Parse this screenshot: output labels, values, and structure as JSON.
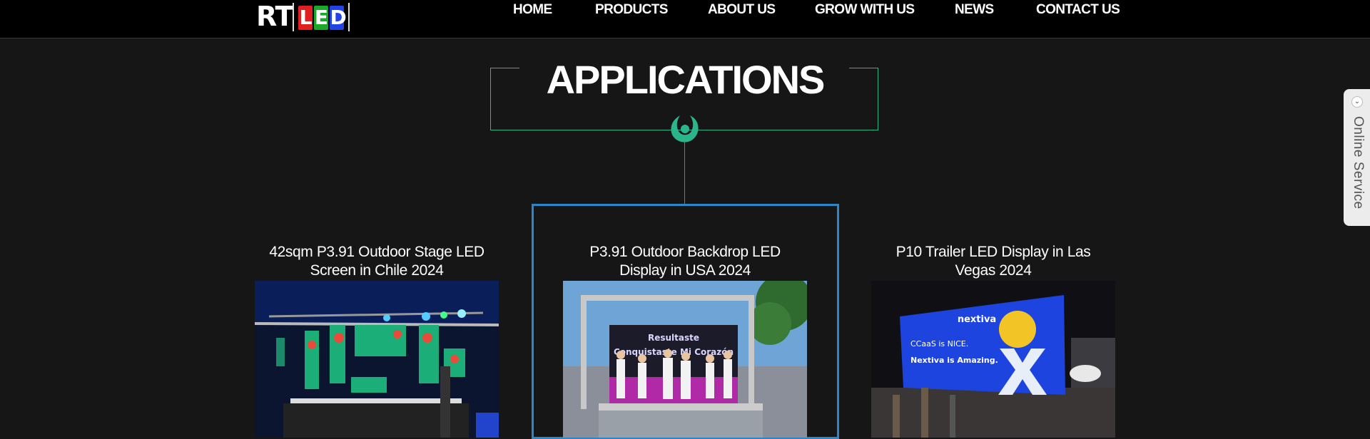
{
  "header": {
    "logo": {
      "text": "RT",
      "letters": [
        "L",
        "E",
        "D"
      ],
      "letter_colors": [
        "#e02020",
        "#1aa82a",
        "#2244e6"
      ]
    },
    "nav": [
      {
        "label": "HOME"
      },
      {
        "label": "PRODUCTS"
      },
      {
        "label": "ABOUT US"
      },
      {
        "label": "GROW WITH US"
      },
      {
        "label": "NEWS"
      },
      {
        "label": "CONTACT US"
      }
    ]
  },
  "section": {
    "title": "APPLICATIONS",
    "accent_color": "#2bb58a",
    "icon": "drop-icon"
  },
  "cards": [
    {
      "title_line1": "42sqm P3.91 Outdoor Stage LED",
      "title_line2": "Screen in Chile 2024",
      "image": "stage-led-screen-image",
      "selected": false
    },
    {
      "title_line1": "P3.91 Outdoor Backdrop LED",
      "title_line2": "Display in USA 2024",
      "image": "backdrop-led-display-image",
      "selected": true,
      "image_text": [
        "Resultaste",
        "Conquistaste Mi Corazón"
      ]
    },
    {
      "title_line1": "P10 Trailer LED Display in Las",
      "title_line2": "Vegas 2024",
      "image": "trailer-led-display-image",
      "selected": false,
      "image_text": [
        "nextiva",
        "CCaaS is NICE.",
        "Nextiva is Amazing."
      ]
    }
  ],
  "highlight_color": "#2e86c8",
  "online_service": {
    "label": "Online Service",
    "toggle_icon": "chevron-down-icon"
  }
}
